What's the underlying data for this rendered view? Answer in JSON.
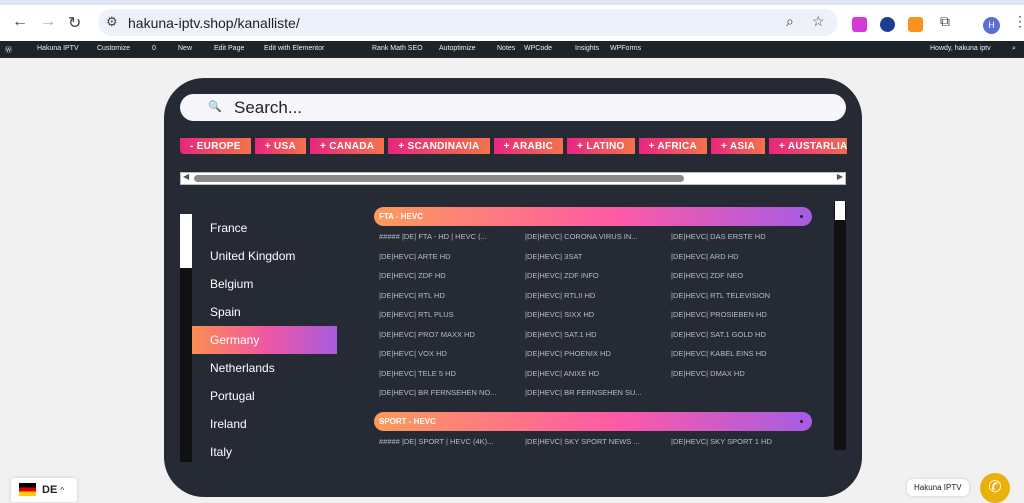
{
  "browser": {
    "url": "hakuna-iptv.shop/kanalliste/",
    "avatar": "H"
  },
  "wp_bar": {
    "items": [
      "Hakuna IPTV",
      "Customize",
      "0",
      "New",
      "Edit Page",
      "Edit with Elementor",
      "Rank Math SEO",
      "Autoptimize",
      "Notes",
      "WPCode",
      "Insights",
      "WPForms"
    ],
    "howdy": "Howdy, hakuna iptv"
  },
  "search": {
    "placeholder": "Search..."
  },
  "regions": [
    "- EUROPE",
    "+ USA",
    "+ CANADA",
    "+ SCANDINAVIA",
    "+ ARABIC",
    "+ LATINO",
    "+ AFRICA",
    "+ ASIA",
    "+ AUSTARLIA"
  ],
  "countries": [
    "France",
    "United Kingdom",
    "Belgium",
    "Spain",
    "Germany",
    "Netherlands",
    "Portugal",
    "Ireland",
    "Italy"
  ],
  "active_country": "Germany",
  "groups": [
    {
      "title": "FTA - HEVC",
      "items": [
        "##### |DE| FTA - HD | HEVC (...",
        "|DE|HEVC| CORONA VIRUS IN...",
        "|DE|HEVC| DAS ERSTE HD",
        "|DE|HEVC| ARTE HD",
        "|DE|HEVC| 3SAT",
        "|DE|HEVC| ARD HD",
        "|DE|HEVC| ZDF HD",
        "|DE|HEVC| ZDF INFO",
        "|DE|HEVC| ZDF NEO",
        "|DE|HEVC| RTL HD",
        "|DE|HEVC| RTLII HD",
        "|DE|HEVC| RTL TELEVISION",
        "|DE|HEVC| RTL PLUS",
        "|DE|HEVC| SIXX HD",
        "|DE|HEVC| PROSIEBEN HD",
        "|DE|HEVC| PRO7 MAXX HD",
        "|DE|HEVC| SAT.1 HD",
        "|DE|HEVC| SAT.1 GOLD HD",
        "|DE|HEVC| VOX HD",
        "|DE|HEVC| PHOENIX HD",
        "|DE|HEVC| KABEL EINS HD",
        "|DE|HEVC| TELE 5 HD",
        "|DE|HEVC| ANIXE HD",
        "|DE|HEVC| DMAX HD",
        "|DE|HEVC| BR FERNSEHEN NO...",
        "|DE|HEVC| BR FERNSEHEN SU..."
      ]
    },
    {
      "title": "SPORT - HEVC",
      "items": [
        "##### |DE| SPORT | HEVC (4K)...",
        "|DE|HEVC| SKY SPORT NEWS ...",
        "|DE|HEVC| SKY SPORT 1 HD"
      ]
    }
  ],
  "language": {
    "code": "DE"
  },
  "whatsapp": {
    "label": "Hakuna IPTV"
  }
}
